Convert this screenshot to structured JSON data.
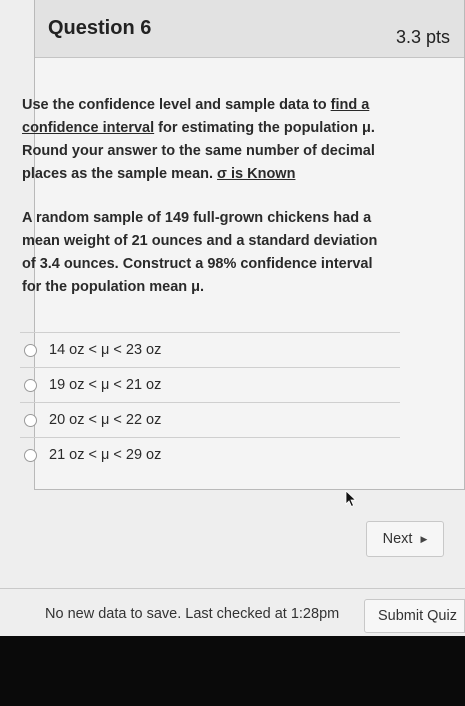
{
  "question": {
    "title": "Question 6",
    "points": "3.3 pts",
    "instructions": {
      "part1": "Use the confidence level and sample data to ",
      "link1": "find a confidence interval",
      "part2": " for estimating the population μ. Round your answer to the same number of decimal places as the sample mean. ",
      "link2": "σ is Known"
    },
    "problem": "A random sample of 149 full-grown chickens had a mean weight of 21 ounces and a standard deviation of 3.4 ounces. Construct a 98% confidence interval for the population mean μ.",
    "answers": [
      "14 oz < μ < 23 oz",
      "19 oz < μ < 21 oz",
      "20 oz < μ < 22 oz",
      "21 oz < μ < 29 oz"
    ]
  },
  "navigation": {
    "next_label": "Next",
    "next_icon": "triangle-right-icon"
  },
  "footer": {
    "status": "No new data to save. Last checked at 1:28pm",
    "submit_label": "Submit Quiz"
  }
}
